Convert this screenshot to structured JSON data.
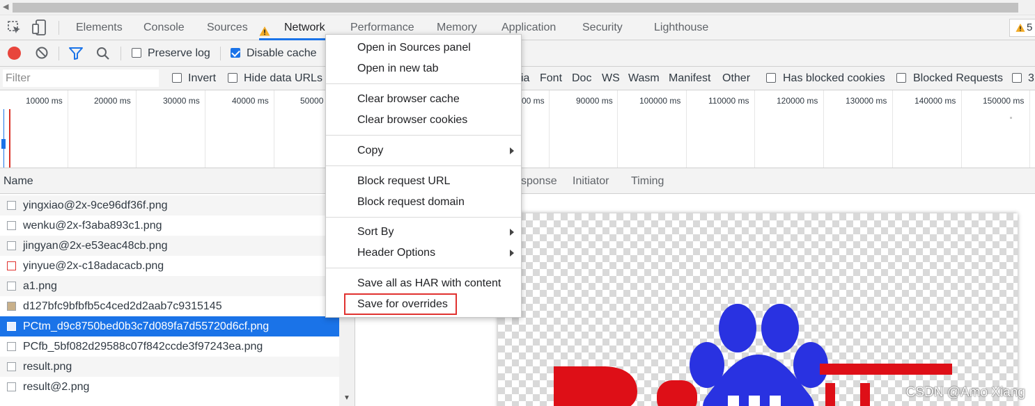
{
  "tabs": {
    "elements": "Elements",
    "console": "Console",
    "sources": "Sources",
    "network": "Network",
    "performance": "Performance",
    "memory": "Memory",
    "application": "Application",
    "security": "Security",
    "lighthouse": "Lighthouse",
    "warning_count": "5"
  },
  "toolbar": {
    "preserve_log": "Preserve log",
    "preserve_log_checked": false,
    "disable_cache": "Disable cache",
    "disable_cache_checked": true
  },
  "filter": {
    "placeholder": "Filter",
    "invert": "Invert",
    "hide_data_urls": "Hide data URLs",
    "types_partial": "ia",
    "types": [
      "Font",
      "Doc",
      "WS",
      "Wasm",
      "Manifest",
      "Other"
    ],
    "has_blocked_cookies": "Has blocked cookies",
    "blocked_requests": "Blocked Requests",
    "extra_partial": "3"
  },
  "overview": {
    "ticks": [
      "10000 ms",
      "20000 ms",
      "30000 ms",
      "40000 ms",
      "50000",
      "00 ms",
      "90000 ms",
      "100000 ms",
      "110000 ms",
      "120000 ms",
      "130000 ms",
      "140000 ms",
      "150000 ms"
    ]
  },
  "list": {
    "header": "Name",
    "rows": [
      "yingxiao@2x-9ce96df36f.png",
      "wenku@2x-f3aba893c1.png",
      "jingyan@2x-e53eac48cb.png",
      "yinyue@2x-c18adacacb.png",
      "a1.png",
      "d127bfc9bfbfb5c4ced2d2aab7c9315145",
      "PCtm_d9c8750bed0b3c7d089fa7d55720d6cf.png",
      "PCfb_5bf082d29588c07f842ccde3f97243ea.png",
      "result.png",
      "result@2.png"
    ],
    "selected_index": 6
  },
  "detail": {
    "tab_response_partial": "sponse",
    "tab_initiator": "Initiator",
    "tab_timing": "Timing"
  },
  "context_menu": {
    "open_in_sources": "Open in Sources panel",
    "open_in_new_tab": "Open in new tab",
    "clear_cache": "Clear browser cache",
    "clear_cookies": "Clear browser cookies",
    "copy": "Copy",
    "block_url": "Block request URL",
    "block_domain": "Block request domain",
    "sort_by": "Sort By",
    "header_options": "Header Options",
    "save_all_har": "Save all as HAR with content",
    "save_for_overrides": "Save for overrides"
  },
  "preview": {
    "logo_name": "baidu-logo",
    "watermark": "CSDN @Amo Xiang"
  },
  "colors": {
    "accent": "#1a73e8",
    "highlight_border": "#e0312f",
    "record_red": "#e8453c",
    "baidu_blue": "#2932e1",
    "baidu_red": "#de0f17"
  }
}
